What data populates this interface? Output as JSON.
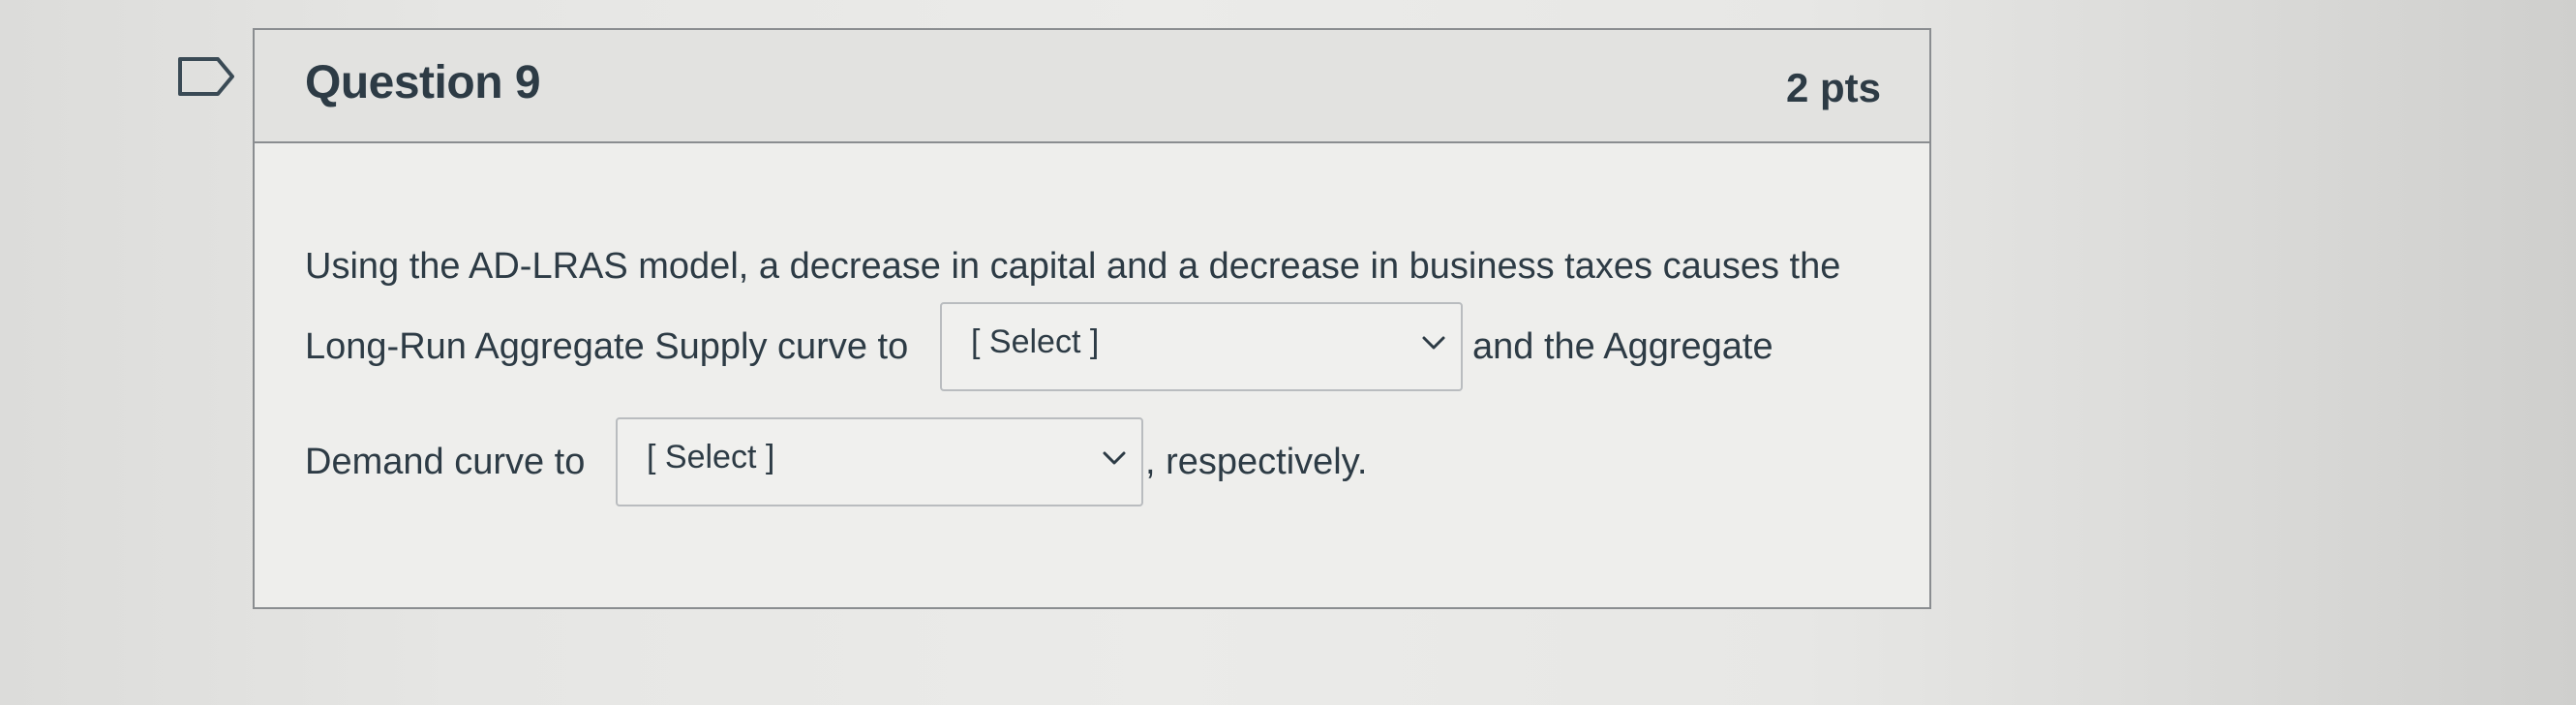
{
  "question": {
    "title": "Question 9",
    "points": "2 pts",
    "text_line1": "Using the AD-LRAS model, a decrease in capital and a decrease in business taxes causes the",
    "text_line2_before": "Long-Run Aggregate Supply curve to",
    "text_line2_after": "and the Aggregate",
    "text_line3_before": "Demand curve to",
    "text_line3_after": ", respectively."
  },
  "dropdowns": [
    {
      "selected": "[ Select ]",
      "icon": "chevron-down-icon"
    },
    {
      "selected": "[ Select ]",
      "icon": "chevron-down-icon"
    }
  ],
  "icons": {
    "flag": "bookmark-flag-icon"
  }
}
